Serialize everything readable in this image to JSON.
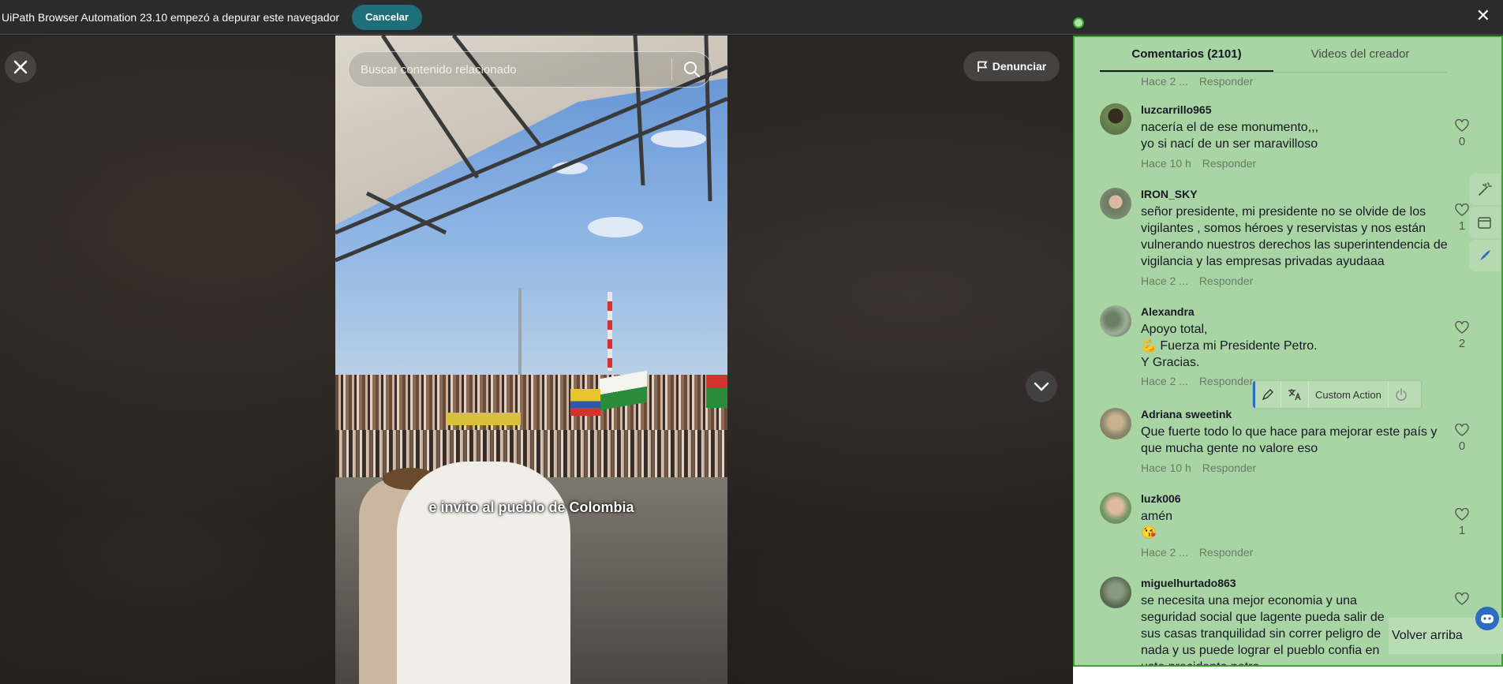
{
  "debugbar": {
    "message": "UiPath Browser Automation 23.10 empezó a depurar este navegador",
    "cancel_label": "Cancelar",
    "close_glyph": "✕"
  },
  "player": {
    "search_placeholder": "Buscar contenido relacionado",
    "report_label": "Denunciar",
    "subtitle": "e invito al pueblo de Colombia"
  },
  "panel": {
    "tabs": [
      {
        "label": "Comentarios (2101)",
        "active": true
      },
      {
        "label": "Videos del creador",
        "active": false
      }
    ],
    "partial_meta": {
      "time": "Hace 2 ...",
      "reply": "Responder"
    },
    "comments": [
      {
        "user": "luzcarrillo965",
        "lines": [
          "nacería el de ese monumento,,,",
          "yo si nací de un ser maravilloso"
        ],
        "time": "Hace 10 h",
        "reply": "Responder",
        "likes": "0"
      },
      {
        "user": "IRON_SKY",
        "lines": [
          "señor presidente, mi presidente no se olvide de los vigilantes , somos héroes y reservistas y nos están vulnerando nuestros derechos las superintendencia de vigilancia y las empresas privadas ayudaaa"
        ],
        "time": "Hace 2 ...",
        "reply": "Responder",
        "likes": "1"
      },
      {
        "user": "Alexandra",
        "lines": [
          "Apoyo total,",
          "💪 Fuerza mi Presidente Petro.",
          "Y Gracias."
        ],
        "time": "Hace 2 ...",
        "reply": "Responder",
        "likes": "2"
      },
      {
        "user": "Adriana sweetink",
        "lines": [
          "Que fuerte todo lo que hace para mejorar este país y que mucha gente no valore eso"
        ],
        "time": "Hace 10 h",
        "reply": "Responder",
        "likes": "0"
      },
      {
        "user": "luzk006",
        "lines": [
          "amén",
          "😘"
        ],
        "time": "Hace 2 ...",
        "reply": "Responder",
        "likes": "1"
      },
      {
        "user": "miguelhurtado863",
        "lines": [
          "se necesita una mejor economia y una seguridad social que lagente pueda salir de sus casas tranquilidad sin correr peligro de nada y us puede lograr el pueblo confia en uste precidente petro"
        ],
        "time": "",
        "reply": "",
        "likes": ""
      }
    ],
    "back_to_top": "Volver arriba"
  },
  "uipath_toolbar": {
    "custom_action": "Custom Action"
  },
  "colors": {
    "highlight_border": "#3aa22f",
    "highlight_fill": "#a9d4a4",
    "cancel_button": "#1f6f7a",
    "accent_blue": "#2b6cc0"
  }
}
